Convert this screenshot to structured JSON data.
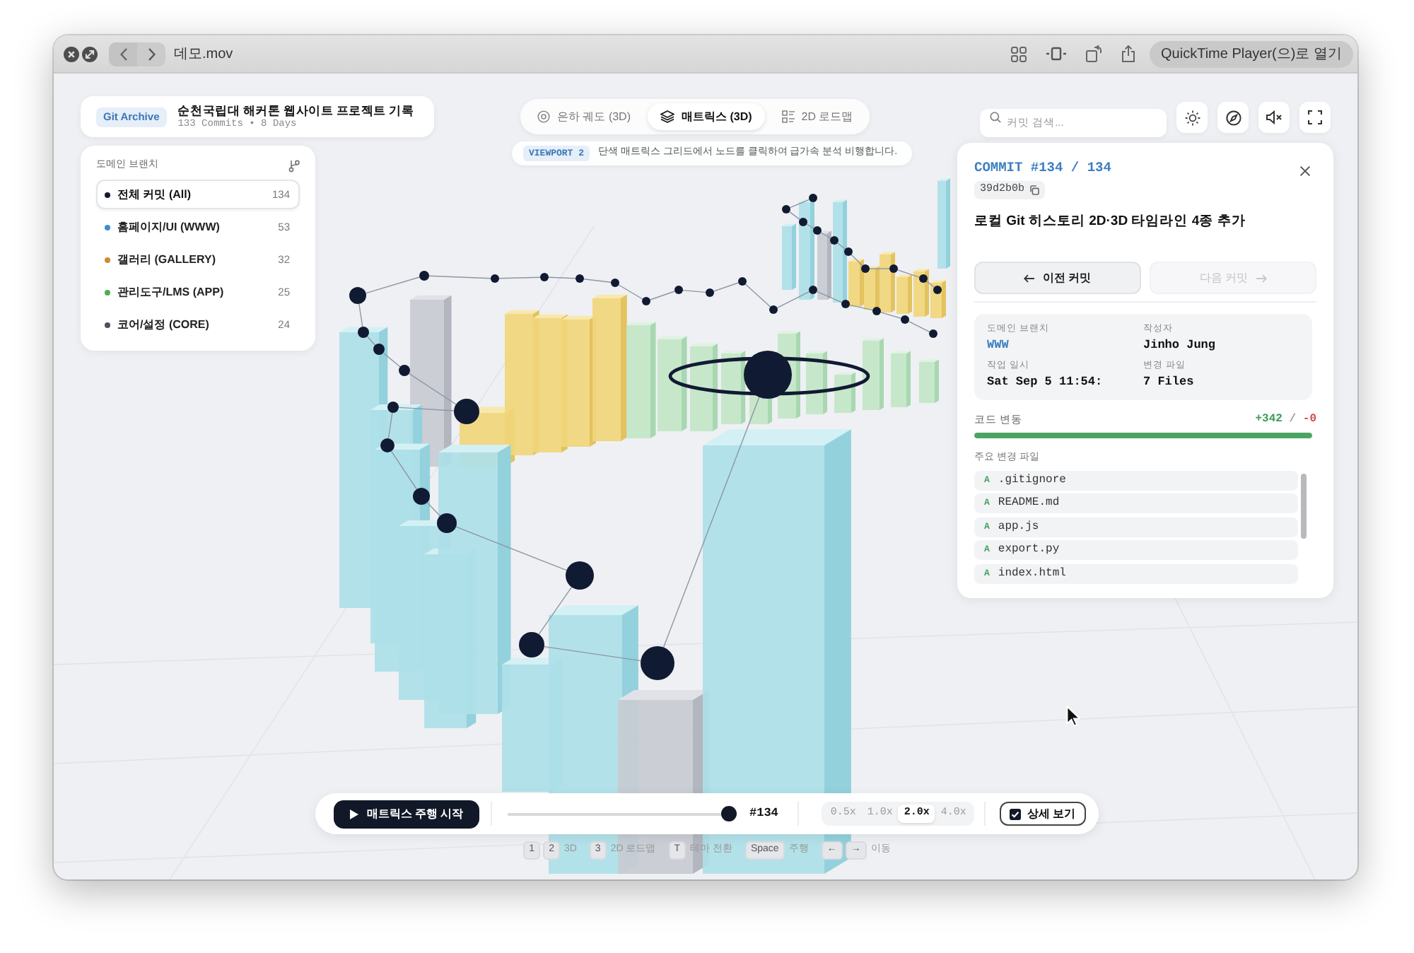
{
  "window": {
    "title": "데모.mov",
    "open_button": "QuickTime Player(으)로 열기"
  },
  "header": {
    "badge": "Git Archive",
    "title": "순천국립대 해커톤 웹사이트 프로젝트 기록",
    "subtitle": "133 Commits • 8 Days"
  },
  "view_tabs": [
    {
      "label": "은하 궤도 (3D)",
      "kind": "orbit",
      "selected": false
    },
    {
      "label": "매트릭스 (3D)",
      "kind": "layers",
      "selected": true
    },
    {
      "label": "2D 로드맵",
      "kind": "roadmap",
      "selected": false
    }
  ],
  "viewport_hint": {
    "badge": "VIEWPORT 2",
    "text": "단색 매트릭스 그리드에서 노드를 클릭하여 급가속 분석 비행합니다."
  },
  "search": {
    "placeholder": "커밋 검색..."
  },
  "branches": {
    "title": "도메인 브랜치",
    "items": [
      {
        "label": "전체 커밋 (All)",
        "count": "134",
        "color": "#151a30",
        "selected": true
      },
      {
        "label": "홈페이지/UI (WWW)",
        "count": "53",
        "color": "#3d8fd1",
        "selected": false
      },
      {
        "label": "갤러리 (GALLERY)",
        "count": "32",
        "color": "#d08a30",
        "selected": false
      },
      {
        "label": "관리도구/LMS (APP)",
        "count": "25",
        "color": "#4caf50",
        "selected": false
      },
      {
        "label": "코어/설정 (CORE)",
        "count": "24",
        "color": "#4b5060",
        "selected": false
      }
    ]
  },
  "commit_panel": {
    "heading": "COMMIT #134 / 134",
    "hash": "39d2b0b",
    "title": "로컬 Git 히스토리 2D·3D 타임라인 4종 추가",
    "prev_button": {
      "label": "이전 커밋",
      "disabled": false
    },
    "next_button": {
      "label": "다음 커밋",
      "disabled": true
    },
    "fields": [
      {
        "label": "도메인 브랜치",
        "value": "WWW",
        "kind": "branch"
      },
      {
        "label": "작성자",
        "value": "Jinho Jung",
        "kind": "text"
      },
      {
        "label": "작업 일시",
        "value": "Sat Sep 5 11:54:",
        "kind": "text"
      },
      {
        "label": "변경 파일",
        "value": "7 Files",
        "kind": "text"
      }
    ],
    "changes": {
      "label": "코드 변동",
      "added": "+342",
      "separator": "/",
      "removed": "-0",
      "level": 1
    },
    "files_label": "주요 변경 파일",
    "files": [
      {
        "status": "A",
        "name": ".gitignore"
      },
      {
        "status": "A",
        "name": "README.md"
      },
      {
        "status": "A",
        "name": "app.js"
      },
      {
        "status": "A",
        "name": "export.py"
      },
      {
        "status": "A",
        "name": "index.html"
      }
    ]
  },
  "player": {
    "play_button": "매트릭스 주행 시작",
    "level": 1,
    "position": "#134",
    "speeds": [
      {
        "label": "0.5x",
        "selected": false
      },
      {
        "label": "1.0x",
        "selected": false
      },
      {
        "label": "2.0x",
        "selected": true
      },
      {
        "label": "4.0x",
        "selected": false
      }
    ],
    "detail_toggle": {
      "label": "상세 보기",
      "checked": true
    }
  },
  "shortcuts": [
    {
      "keys": [
        "1",
        "2"
      ],
      "label": "3D"
    },
    {
      "keys": [
        "3"
      ],
      "label": "2D 로드맵"
    },
    {
      "keys": [
        "T"
      ],
      "label": "테마 전환"
    },
    {
      "keys": [
        "Space"
      ],
      "label": "주행"
    },
    {
      "keys": [
        "←",
        "→"
      ],
      "label": "이동"
    }
  ]
}
